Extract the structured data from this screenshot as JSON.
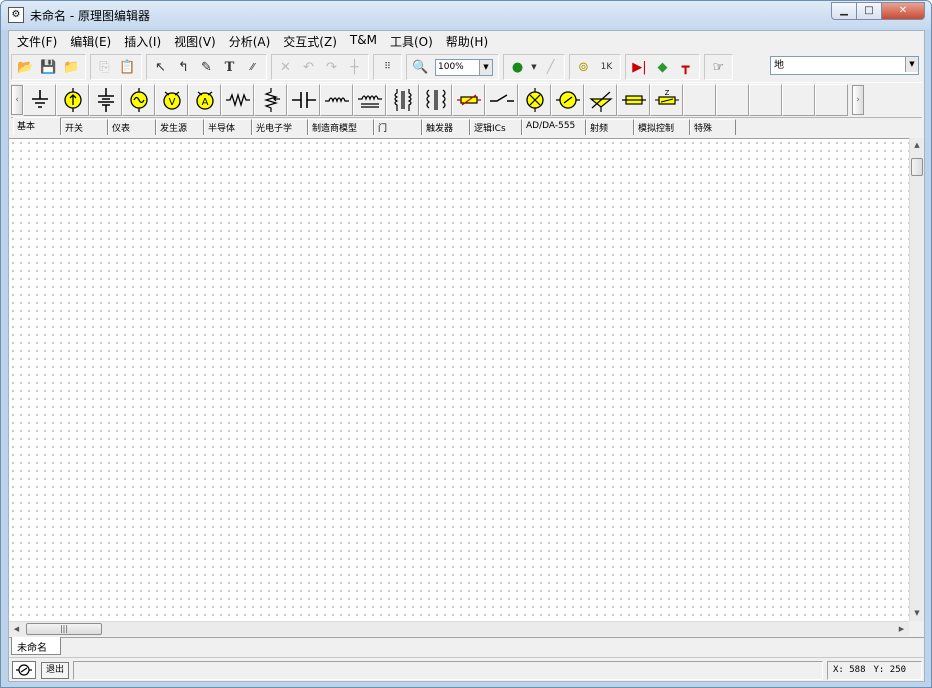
{
  "window": {
    "title": "未命名 - 原理图编辑器",
    "icon": "schematic-app-icon",
    "controls": [
      "minimize-icon",
      "maximize-icon",
      "close-icon"
    ]
  },
  "menu": [
    {
      "label": "文件(F)"
    },
    {
      "label": "编辑(E)"
    },
    {
      "label": "插入(I)"
    },
    {
      "label": "视图(V)"
    },
    {
      "label": "分析(A)"
    },
    {
      "label": "交互式(Z)"
    },
    {
      "label": "T&M"
    },
    {
      "label": "工具(O)"
    },
    {
      "label": "帮助(H)"
    }
  ],
  "toolbar": {
    "zoom": "100%",
    "label_field": "地"
  },
  "parts": [
    "ground-icon",
    "dc-current-source-icon",
    "battery-icon",
    "ac-voltage-source-icon",
    "voltmeter-icon",
    "ammeter-icon",
    "resistor-icon",
    "potentiometer-icon",
    "capacitor-icon",
    "inductor-icon",
    "variable-inductor-icon",
    "transformer-icon",
    "coupled-inductor-icon",
    "relay-icon",
    "switch-icon",
    "lamp-icon",
    "motor-icon",
    "variable-capacitor-icon",
    "fuse-icon",
    "impedance-icon"
  ],
  "tabs": [
    {
      "label": "基本"
    },
    {
      "label": "开关"
    },
    {
      "label": "仪表"
    },
    {
      "label": "发生源"
    },
    {
      "label": "半导体"
    },
    {
      "label": "光电子学"
    },
    {
      "label": "制造商模型"
    },
    {
      "label": "门"
    },
    {
      "label": "触发器"
    },
    {
      "label": "逻辑ICs"
    },
    {
      "label": "AD/DA-555"
    },
    {
      "label": "射频"
    },
    {
      "label": "模拟控制"
    },
    {
      "label": "特殊"
    }
  ],
  "document_tab": "未命名",
  "status": {
    "exit_label": "退出",
    "x": "X: 588",
    "y": "Y: 250"
  },
  "colors": {
    "part_fill": "#ffff00",
    "canvas_grid": "#b9b9b9",
    "title_gradient": "#c4d8ee"
  }
}
